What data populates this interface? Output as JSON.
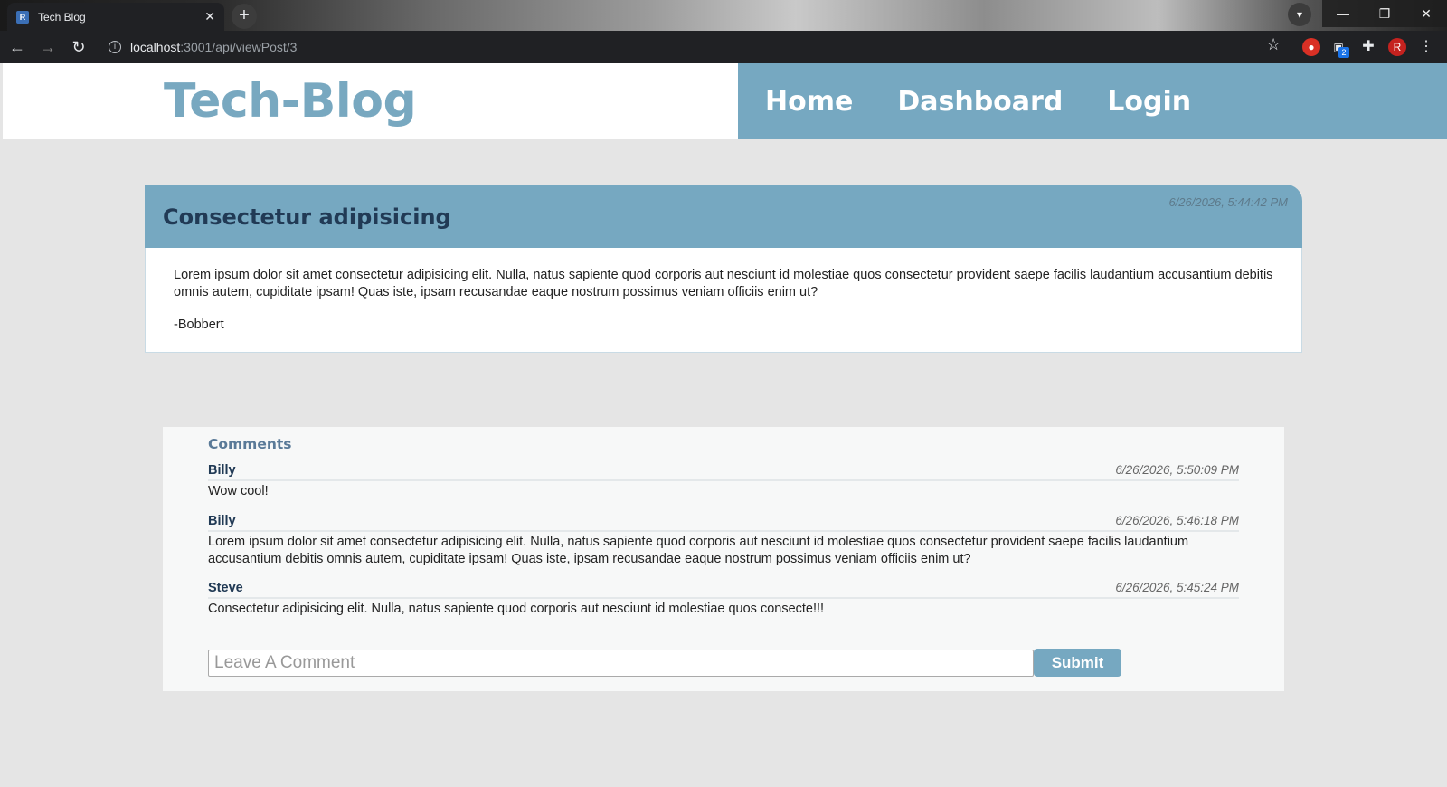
{
  "browser": {
    "tab_title": "Tech Blog",
    "favicon_letter": "R",
    "url_host": "localhost",
    "url_path": ":3001/api/viewPost/3",
    "extension_badge": "2",
    "profile_initial": "R"
  },
  "site": {
    "brand": "Tech-Blog",
    "nav": [
      {
        "label": "Home"
      },
      {
        "label": "Dashboard"
      },
      {
        "label": "Login"
      }
    ]
  },
  "post": {
    "title": "Consectetur adipisicing",
    "date": "6/26/2026, 5:44:42 PM",
    "body": "Lorem ipsum dolor sit amet consectetur adipisicing elit. Nulla, natus sapiente quod corporis aut nesciunt id molestiae quos consectetur provident saepe facilis laudantium accusantium debitis omnis autem, cupiditate ipsam! Quas iste, ipsam recusandae eaque nostrum possimus veniam officiis enim ut?",
    "author": "-Bobbert"
  },
  "comments": {
    "heading": "Comments",
    "items": [
      {
        "user": "Billy",
        "date": "6/26/2026, 5:50:09 PM",
        "text": "Wow cool!"
      },
      {
        "user": "Billy",
        "date": "6/26/2026, 5:46:18 PM",
        "text": "Lorem ipsum dolor sit amet consectetur adipisicing elit. Nulla, natus sapiente quod corporis aut nesciunt id molestiae quos consectetur provident saepe facilis laudantium accusantium debitis omnis autem, cupiditate ipsam! Quas iste, ipsam recusandae eaque nostrum possimus veniam officiis enim ut?"
      },
      {
        "user": "Steve",
        "date": "6/26/2026, 5:45:24 PM",
        "text": "Consectetur adipisicing elit. Nulla, natus sapiente quod corporis aut nesciunt id molestiae quos consecte!!!"
      }
    ],
    "input_placeholder": "Leave A Comment",
    "input_value": "",
    "submit_label": "Submit"
  }
}
